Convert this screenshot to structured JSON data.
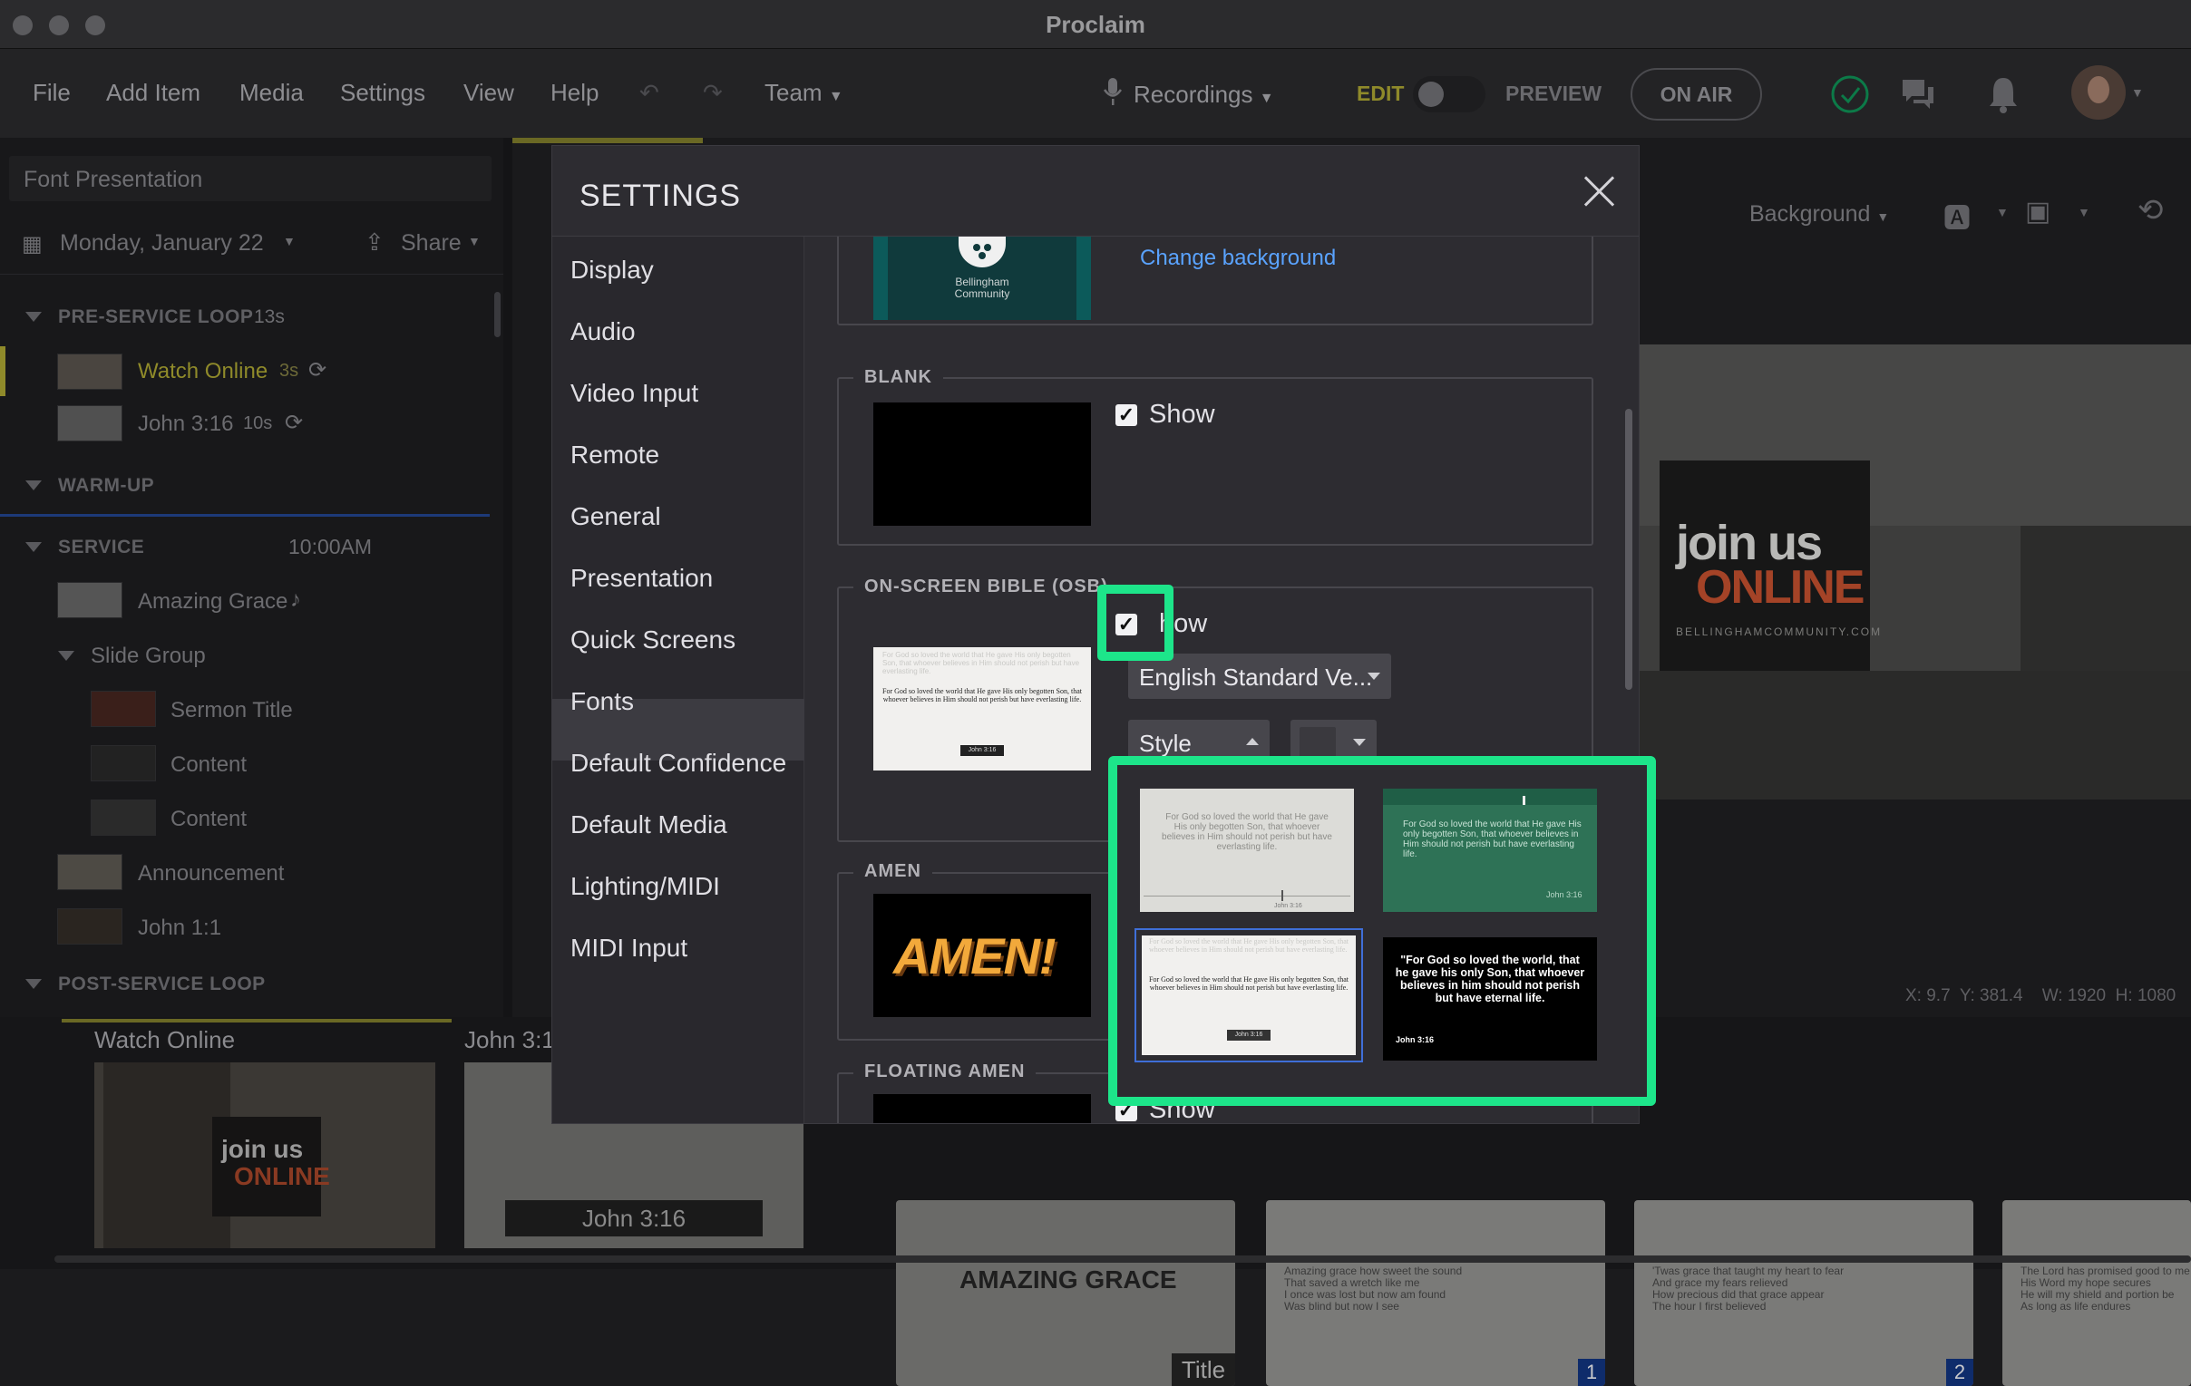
{
  "window": {
    "title": "Proclaim"
  },
  "menu": {
    "items": [
      "File",
      "Add Item",
      "Media",
      "Settings",
      "View",
      "Help"
    ],
    "team": "Team",
    "recordings": "Recordings",
    "edit": "EDIT",
    "preview": "PREVIEW",
    "on_air": "ON AIR"
  },
  "sidebar": {
    "presentation_name": "Font Presentation",
    "date": "Monday, January 22",
    "share": "Share",
    "sections": [
      {
        "title": "PRE-SERVICE LOOP",
        "duration": "13s"
      },
      {
        "title": "WARM-UP"
      },
      {
        "title": "SERVICE",
        "time": "10:00AM"
      },
      {
        "title": "POST-SERVICE LOOP"
      }
    ],
    "items": {
      "watch_online": "Watch Online",
      "watch_online_dur": "3s",
      "john316": "John 3:16",
      "john316_dur": "10s",
      "amazing_grace": "Amazing Grace",
      "slide_group": "Slide Group",
      "sermon_title": "Sermon Title",
      "content1": "Content",
      "content2": "Content",
      "announcement": "Announcement",
      "john11": "John 1:1"
    }
  },
  "editor": {
    "background": "Background",
    "coords": "X: 9.7  Y: 381.4    W: 1920  H: 1080"
  },
  "preview_slide": {
    "line1": "join us",
    "line2": "ONLINE",
    "url": "BELLINGHAMCOMMUNITY.COM"
  },
  "bottom_strip": {
    "card1_title": "Watch Online",
    "card2_title": "John 3:1",
    "card2_ref": "John 3:16",
    "card3_title": "AMAZING GRACE",
    "card3_badge": "Title",
    "card4_lines": [
      "Amazing grace how sweet the sound",
      "That saved a wretch like me",
      "I once was lost but now am found",
      "Was blind but now I see"
    ],
    "card4_num": "1",
    "card5_lines": [
      "'Twas grace that taught my heart to fear",
      "And grace my fears relieved",
      "How precious did that grace appear",
      "The hour I first believed"
    ],
    "card5_num": "2",
    "card6_lines": [
      "The Lord has promised good to me",
      "His Word my hope secures",
      "He will my shield and portion be",
      "As long as life endures"
    ]
  },
  "settings": {
    "title": "SETTINGS",
    "nav": [
      "Display",
      "Audio",
      "Video Input",
      "Remote",
      "General",
      "Presentation",
      "Quick Screens",
      "Fonts",
      "Default Confidence",
      "Default Media",
      "Lighting/MIDI",
      "MIDI Input"
    ],
    "active_nav": "Quick Screens",
    "change_background": "Change background",
    "logo_text": "Bellingham Community",
    "blank": {
      "label": "BLANK",
      "show": "Show"
    },
    "osb": {
      "label": "ON-SCREEN BIBLE (OSB)",
      "show": "how",
      "translation": "English Standard Ve...",
      "style": "Style",
      "preview_verse": "For God so loved the world that He gave His only begotten Son, that whoever believes in Him should not perish but have everlasting life.",
      "preview_ref": "John 3:16"
    },
    "amen": {
      "label": "AMEN",
      "graphic": "AMEN!"
    },
    "floating_amen": {
      "label": "FLOATING AMEN",
      "show": "Show"
    },
    "style_options": [
      {
        "text": "For God so loved the world that He gave His only begotten Son, that whoever believes in Him should not perish but have everlasting life.",
        "ref": "John 3:16"
      },
      {
        "text": "For God so loved the world that He gave His only begotten Son, that whoever believes in Him should not perish but have everlasting life.",
        "ref": "John 3:16"
      },
      {
        "text": "For God so loved the world that He gave His only begotten Son, that whoever believes in Him should not perish but have everlasting life.",
        "ref": "John 3:16"
      },
      {
        "text": "\"For God so loved the world, that he gave his only Son, that whoever believes in him should not perish but have eternal life.",
        "ref": "John 3:16"
      }
    ]
  },
  "colors": {
    "highlight": "#1de58a",
    "accent_yellow": "#8f8a2a",
    "link": "#5aa3ff"
  }
}
